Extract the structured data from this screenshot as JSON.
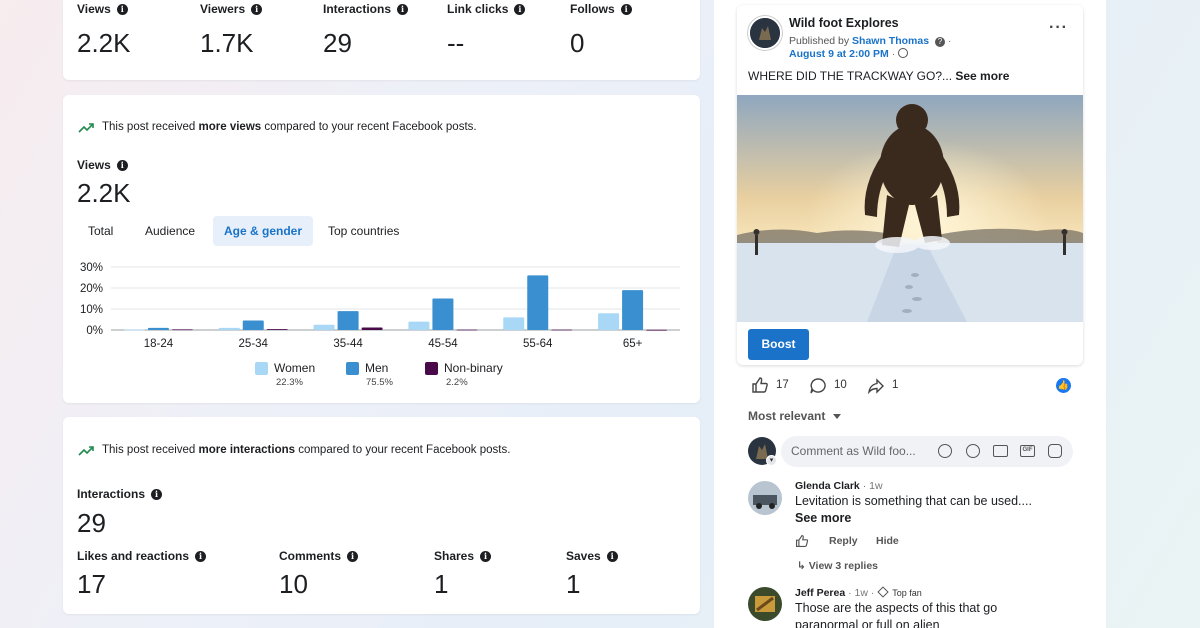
{
  "summary": {
    "metrics": [
      {
        "label": "Views",
        "value": "2.2K"
      },
      {
        "label": "Viewers",
        "value": "1.7K"
      },
      {
        "label": "Interactions",
        "value": "29"
      },
      {
        "label": "Link clicks",
        "value": "--"
      },
      {
        "label": "Follows",
        "value": "0"
      }
    ]
  },
  "views_card": {
    "note_pre": "This post received ",
    "note_bold": "more views",
    "note_post": " compared to your recent Facebook posts.",
    "label": "Views",
    "value": "2.2K",
    "tabs": [
      "Total",
      "Audience",
      "Age & gender",
      "Top countries"
    ],
    "active_tab": "Age & gender",
    "legend": [
      {
        "name": "Women",
        "pct": "22.3%",
        "color": "#a8d8f5"
      },
      {
        "name": "Men",
        "pct": "75.5%",
        "color": "#3a8fd0"
      },
      {
        "name": "Non-binary",
        "pct": "2.2%",
        "color": "#4a0a4a"
      }
    ]
  },
  "chart_data": {
    "type": "bar",
    "categories": [
      "18-24",
      "25-34",
      "35-44",
      "45-54",
      "55-64",
      "65+"
    ],
    "series": [
      {
        "name": "Women",
        "values": [
          0.2,
          1.0,
          2.5,
          4.0,
          6.0,
          8.0
        ],
        "color": "#a8d8f5"
      },
      {
        "name": "Men",
        "values": [
          1.0,
          4.5,
          9.0,
          15.0,
          26.0,
          19.0
        ],
        "color": "#3a8fd0"
      },
      {
        "name": "Non-binary",
        "values": [
          0.3,
          0.4,
          1.2,
          0.2,
          0.2,
          0.1
        ],
        "color": "#4a0a4a"
      }
    ],
    "yticks": [
      "30%",
      "20%",
      "10%",
      "0%"
    ],
    "ylim": [
      0,
      30
    ],
    "grid": true
  },
  "interactions_card": {
    "note_pre": "This post received ",
    "note_bold": "more interactions",
    "note_post": " compared to your recent Facebook posts.",
    "label": "Interactions",
    "value": "29",
    "breakdown": [
      {
        "label": "Likes and reactions",
        "value": "17"
      },
      {
        "label": "Comments",
        "value": "10"
      },
      {
        "label": "Shares",
        "value": "1"
      },
      {
        "label": "Saves",
        "value": "1"
      }
    ]
  },
  "post": {
    "page_name": "Wild foot Explores",
    "published_by_pre": "Published by ",
    "publisher": "Shawn Thomas",
    "date": "August 9 at 2:00 PM",
    "text": "WHERE DID THE TRACKWAY GO?...",
    "see_more": "See more",
    "boost_label": "Boost",
    "likes": "17",
    "comments": "10",
    "shares": "1",
    "sort_label": "Most relevant",
    "comment_placeholder": "Comment as Wild foo...",
    "brand_color": "#1877f2"
  },
  "comments": [
    {
      "author": "Glenda Clark",
      "time": "1w",
      "badge": "",
      "text": "Levitation is something that can be used....",
      "see_more": "See more",
      "reply_label": "Reply",
      "hide_label": "Hide",
      "view_replies": "View 3 replies"
    },
    {
      "author": "Jeff Perea",
      "time": "1w",
      "badge": "Top fan",
      "text": "Those are the aspects of this that go",
      "text2": "paranormal or full on alien"
    }
  ]
}
